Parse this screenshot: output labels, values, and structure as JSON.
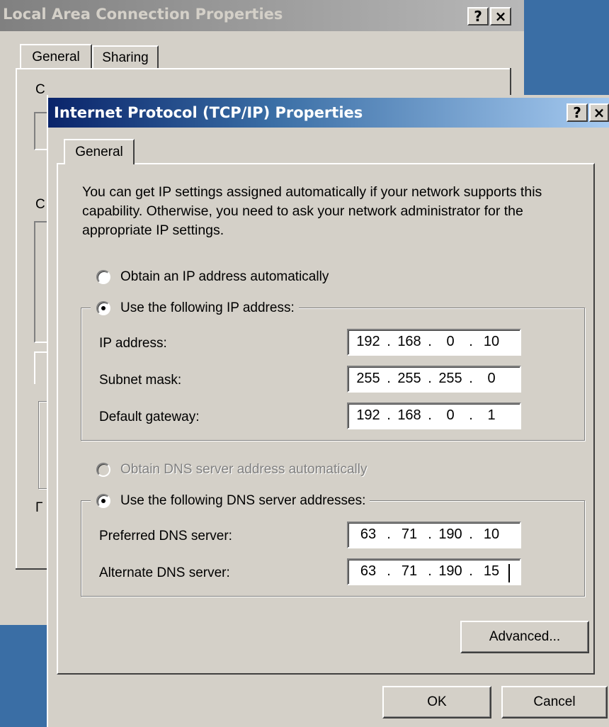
{
  "back_window": {
    "title": "Local Area Connection Properties",
    "help_btn": "?",
    "close_btn": "×",
    "tabs": [
      "General",
      "Sharing"
    ],
    "frag1": "C",
    "frag2": "C",
    "frag3": "Г"
  },
  "dialog": {
    "title": "Internet Protocol (TCP/IP) Properties",
    "help_btn": "?",
    "close_btn": "×",
    "tab": "General",
    "intro": "You can get IP settings assigned automatically if your network supports this capability. Otherwise, you need to ask your network administrator for the appropriate IP settings.",
    "ip_section": {
      "auto_label": "Obtain an IP address automatically",
      "manual_label": "Use the following IP address:",
      "fields": [
        {
          "label": "IP address:",
          "octets": [
            "192",
            "168",
            "0",
            "10"
          ]
        },
        {
          "label": "Subnet mask:",
          "octets": [
            "255",
            "255",
            "255",
            "0"
          ]
        },
        {
          "label": "Default gateway:",
          "octets": [
            "192",
            "168",
            "0",
            "1"
          ]
        }
      ]
    },
    "dns_section": {
      "auto_label": "Obtain DNS server address automatically",
      "manual_label": "Use the following DNS server addresses:",
      "fields": [
        {
          "label": "Preferred DNS server:",
          "octets": [
            "63",
            "71",
            "190",
            "10"
          ]
        },
        {
          "label": "Alternate DNS server:",
          "octets": [
            "63",
            "71",
            "190",
            "15"
          ]
        }
      ]
    },
    "advanced_label": "Advanced...",
    "ok_label": "OK",
    "cancel_label": "Cancel"
  }
}
